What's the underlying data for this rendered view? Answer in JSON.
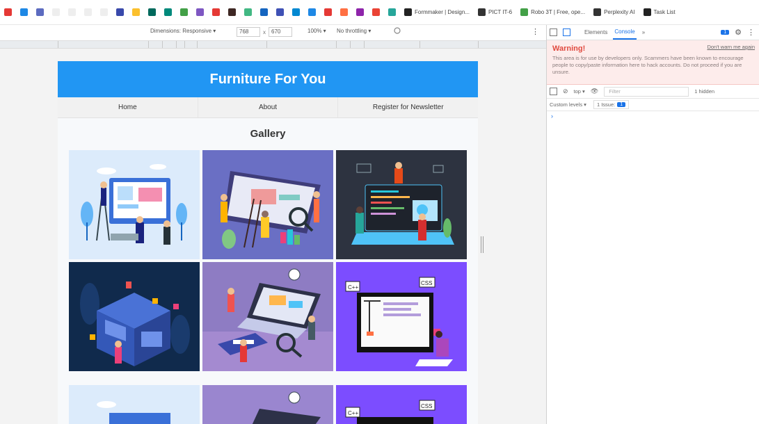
{
  "bookmarks": [
    {
      "icon": "red-icon",
      "color": "#e53935",
      "label": ""
    },
    {
      "icon": "doc-icon",
      "color": "#1e88e5",
      "label": ""
    },
    {
      "icon": "pen-icon",
      "color": "#5c6bc0",
      "label": ""
    },
    {
      "icon": "blank-icon",
      "color": "#eeeeee",
      "label": ""
    },
    {
      "icon": "blank-icon",
      "color": "#eeeeee",
      "label": ""
    },
    {
      "icon": "blank-icon",
      "color": "#eeeeee",
      "label": ""
    },
    {
      "icon": "blank-icon",
      "color": "#eeeeee",
      "label": ""
    },
    {
      "icon": "grid-icon",
      "color": "#3949ab",
      "label": ""
    },
    {
      "icon": "sun-icon",
      "color": "#fbc02d",
      "label": ""
    },
    {
      "icon": "app-icon",
      "color": "#00695c",
      "label": ""
    },
    {
      "icon": "app-icon",
      "color": "#00897b",
      "label": ""
    },
    {
      "icon": "app-icon",
      "color": "#43a047",
      "label": ""
    },
    {
      "icon": "app-icon",
      "color": "#7e57c2",
      "label": ""
    },
    {
      "icon": "app-icon",
      "color": "#e53935",
      "label": ""
    },
    {
      "icon": "app-icon",
      "color": "#3e2723",
      "label": ""
    },
    {
      "icon": "vue-icon",
      "color": "#42b883",
      "label": ""
    },
    {
      "icon": "app-icon",
      "color": "#1565c0",
      "label": ""
    },
    {
      "icon": "app-icon",
      "color": "#3f51b5",
      "label": ""
    },
    {
      "icon": "app-icon",
      "color": "#0288d1",
      "label": ""
    },
    {
      "icon": "app-icon",
      "color": "#1e88e5",
      "label": ""
    },
    {
      "icon": "app-icon",
      "color": "#e53935",
      "label": ""
    },
    {
      "icon": "app-icon",
      "color": "#ff7043",
      "label": ""
    },
    {
      "icon": "app-icon",
      "color": "#8e24aa",
      "label": ""
    },
    {
      "icon": "gmail-icon",
      "color": "#ea4335",
      "label": ""
    },
    {
      "icon": "app-icon",
      "color": "#26a69a",
      "label": ""
    },
    {
      "icon": "formmaker-icon",
      "color": "#222222",
      "label": "Formmaker | Design..."
    },
    {
      "icon": "doc-icon",
      "color": "#333333",
      "label": "PICT IT-6"
    },
    {
      "icon": "leaf-icon",
      "color": "#43a047",
      "label": "Robo 3T | Free, ope..."
    },
    {
      "icon": "perplexity-icon",
      "color": "#333333",
      "label": "Perplexity AI"
    },
    {
      "icon": "check-icon",
      "color": "#222222",
      "label": "Task List"
    }
  ],
  "device_toolbar": {
    "dimensions_label": "Dimensions: Responsive ▾",
    "width": "768",
    "x": "x",
    "height": "670",
    "zoom": "100% ▾",
    "throttle": "No throttling ▾",
    "menu": "⋮"
  },
  "site": {
    "title": "Furniture For You",
    "nav": [
      "Home",
      "About",
      "Register for Newsletter"
    ],
    "gallery_title": "Gallery"
  },
  "devtools": {
    "tabs": [
      "Elements",
      "Console",
      "»"
    ],
    "active_tab": "Console",
    "badge": "1",
    "warning_title": "Warning!",
    "warning_link": "Don't warn me again",
    "warning_text": "This area is for use by developers only. Scammers have been known to encourage people to copy/paste information here to hack accounts. Do not proceed if you are unsure.",
    "context": "top ▾",
    "filter_placeholder": "Filter",
    "hidden_count": "1 hidden",
    "levels": "Custom levels ▾",
    "issues": "1 Issue:",
    "issues_badge": "1",
    "prompt": "›"
  },
  "colors": {
    "header_blue": "#2196f3",
    "accent_blue": "#1a73e8",
    "warning_red": "#e04a3f"
  }
}
